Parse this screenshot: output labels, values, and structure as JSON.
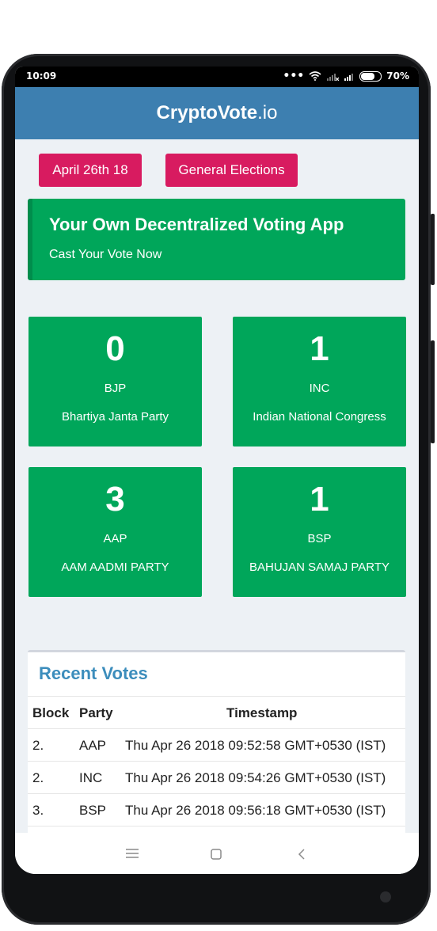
{
  "status": {
    "time": "10:09",
    "battery": "70%"
  },
  "app": {
    "title_bold": "CryptoVote",
    "title_suffix": ".io"
  },
  "chips": {
    "date": "April 26th 18",
    "election": "General Elections"
  },
  "hero": {
    "title": "Your Own Decentralized Voting App",
    "subtitle": "Cast Your Vote Now"
  },
  "parties": [
    {
      "votes": "0",
      "abbr": "BJP",
      "name": "Bhartiya Janta Party"
    },
    {
      "votes": "1",
      "abbr": "INC",
      "name": "Indian National Congress"
    },
    {
      "votes": "3",
      "abbr": "AAP",
      "name": "AAM AADMI PARTY"
    },
    {
      "votes": "1",
      "abbr": "BSP",
      "name": "BAHUJAN SAMAJ PARTY"
    }
  ],
  "recent": {
    "title": "Recent Votes",
    "headers": [
      "Block",
      "Party",
      "Timestamp"
    ],
    "rows": [
      [
        "2.",
        "AAP",
        "Thu Apr 26 2018 09:52:58 GMT+0530 (IST)"
      ],
      [
        "2.",
        "INC",
        "Thu Apr 26 2018 09:54:26 GMT+0530 (IST)"
      ],
      [
        "3.",
        "BSP",
        "Thu Apr 26 2018 09:56:18 GMT+0530 (IST)"
      ]
    ]
  },
  "icons": {
    "menu": "menu-icon",
    "home": "home-square-icon",
    "back": "back-chevron-icon"
  },
  "colors": {
    "header": "#3d7fb0",
    "chip": "#d81b60",
    "card": "#00a65a",
    "title": "#3c8dbc"
  }
}
